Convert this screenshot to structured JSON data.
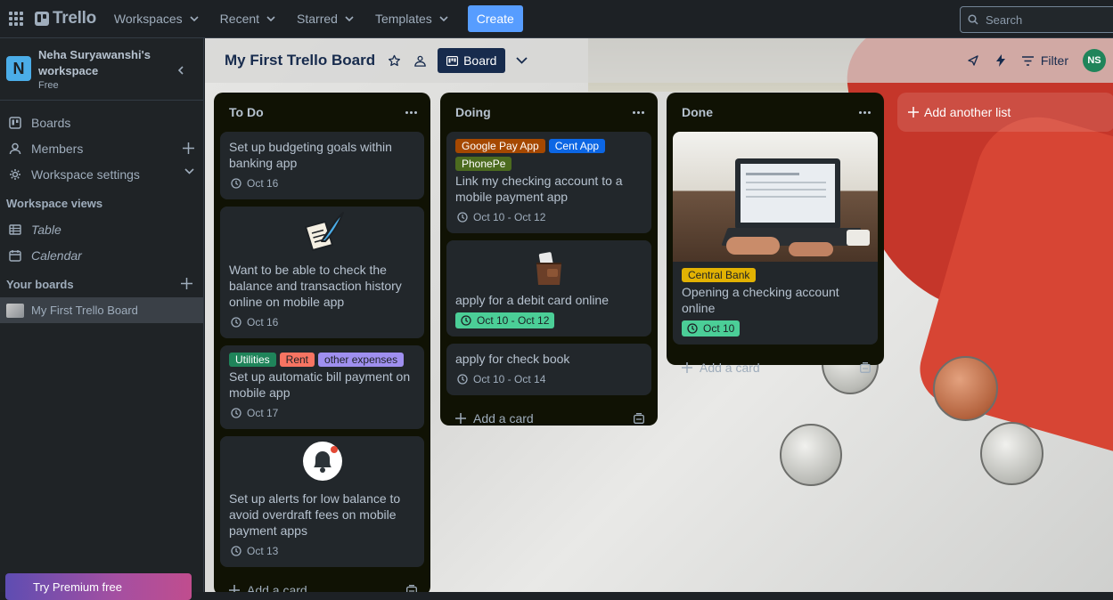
{
  "topbar": {
    "logo": "Trello",
    "nav": [
      "Workspaces",
      "Recent",
      "Starred",
      "Templates"
    ],
    "create_label": "Create",
    "search_placeholder": "Search"
  },
  "sidebar": {
    "workspace_initial": "N",
    "workspace_name": "Neha Suryawanshi's workspace",
    "workspace_plan": "Free",
    "items": [
      {
        "label": "Boards",
        "icon": "trello-icon"
      },
      {
        "label": "Members",
        "icon": "person-icon"
      },
      {
        "label": "Workspace settings",
        "icon": "gear-icon"
      }
    ],
    "views_heading": "Workspace views",
    "views": [
      {
        "label": "Table",
        "icon": "table-icon"
      },
      {
        "label": "Calendar",
        "icon": "calendar-icon"
      }
    ],
    "your_boards_heading": "Your boards",
    "boards": [
      "My First Trello Board"
    ],
    "premium_label": "Try Premium free"
  },
  "board": {
    "title": "My First Trello Board",
    "view_label": "Board",
    "filter_label": "Filter",
    "member_initials": "NS",
    "add_list_label": "Add another list"
  },
  "lists": [
    {
      "title": "To Do",
      "add_card": "Add a card",
      "cards": [
        {
          "title": "Set up budgeting goals within banking app",
          "date": "Oct 16"
        },
        {
          "title": "Want to be able to check the balance and transaction history online on mobile app",
          "date": "Oct 16",
          "cover_icon": "quill-paper-icon"
        },
        {
          "title": "Set up automatic bill payment on mobile app",
          "date": "Oct 17",
          "labels": [
            "Utilities",
            "Rent",
            "other expenses"
          ]
        },
        {
          "title": "Set up alerts for low balance to avoid overdraft fees on mobile payment apps",
          "date": "Oct 13",
          "cover_icon": "notification-bell-icon"
        }
      ]
    },
    {
      "title": "Doing",
      "add_card": "Add a card",
      "cards": [
        {
          "title": "Link my checking account to a mobile payment app",
          "date": "Oct 10 - Oct 12",
          "labels": [
            "Google Pay App",
            "Cent App",
            "PhonePe"
          ]
        },
        {
          "title": "apply for a debit card online",
          "date": "Oct 10 - Oct 12",
          "cover_icon": "wallet-card-icon"
        },
        {
          "title": "apply for check book",
          "date": "Oct 10 - Oct 14"
        }
      ]
    },
    {
      "title": "Done",
      "add_card": "Add a card",
      "cards": [
        {
          "title": "Opening a checking account online",
          "date": "Oct 10",
          "labels": [
            "Central Bank"
          ],
          "cover_image": "laptop-photo"
        }
      ]
    }
  ],
  "colors": {
    "label_utilities": "#1f845a",
    "label_rent": "#f87462",
    "label_other": "#9f8fef",
    "label_google_pay": "#a54800",
    "label_cent_app": "#0c66e4",
    "label_phonepe": "#4c6b1f",
    "label_central_bank": "#e2b203",
    "date_complete": "#4bce97"
  }
}
